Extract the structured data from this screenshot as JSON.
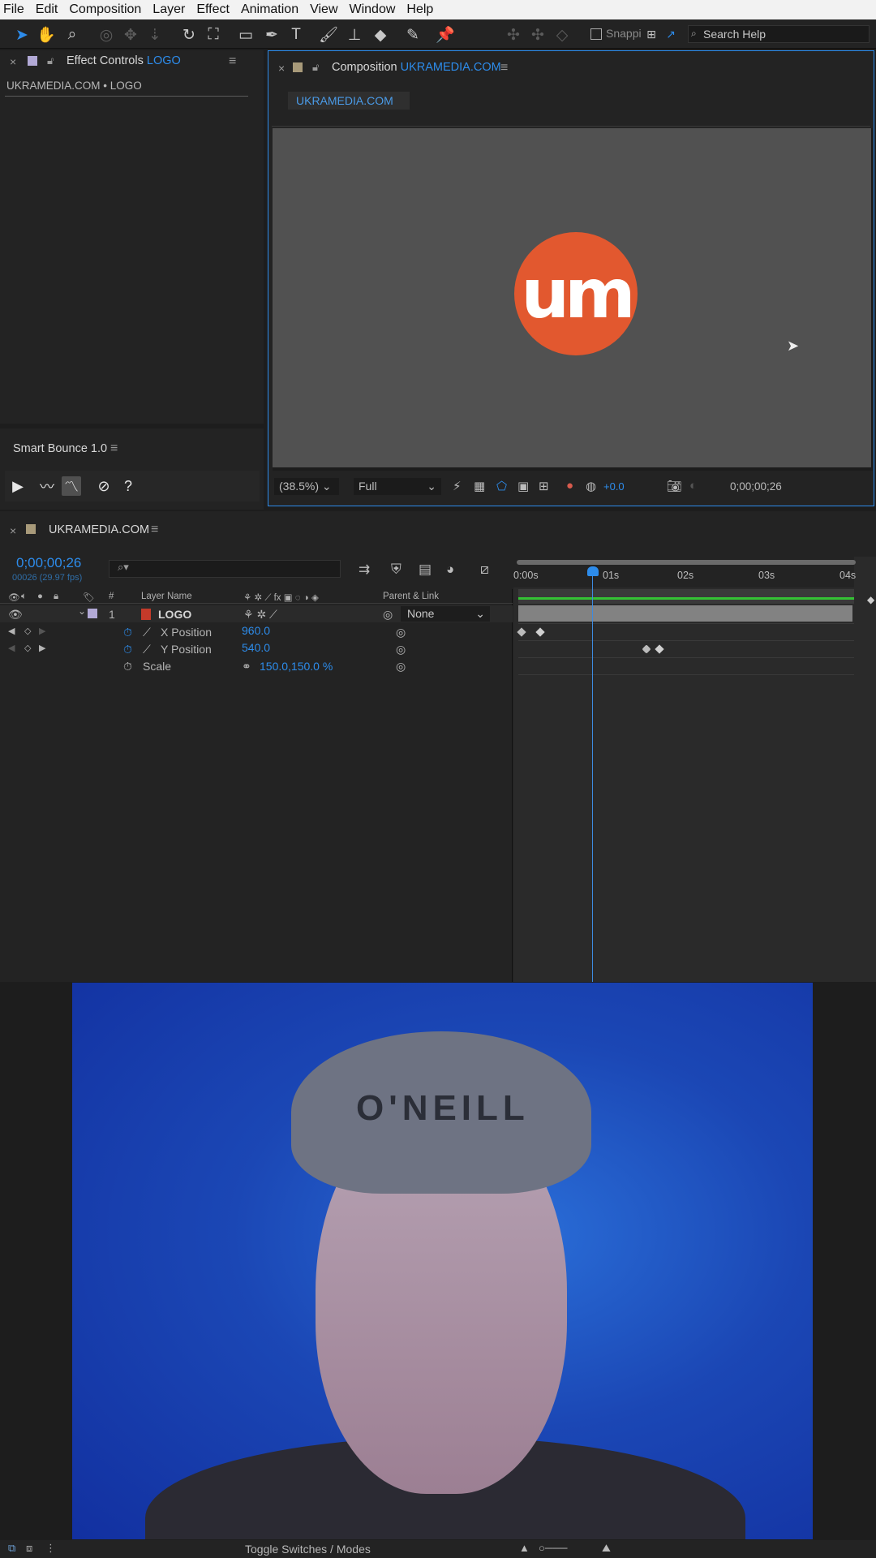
{
  "menu": [
    "File",
    "Edit",
    "Composition",
    "Layer",
    "Effect",
    "Animation",
    "View",
    "Window",
    "Help"
  ],
  "toolbar": {
    "snapping_label": "Snappi",
    "search_placeholder": "Search Help"
  },
  "effect_controls": {
    "title_prefix": "Effect Controls",
    "title_layer": "LOGO",
    "subtitle": "UKRAMEDIA.COM • LOGO"
  },
  "smart_bounce": {
    "title": "Smart Bounce 1.0",
    "help_label": "?"
  },
  "composition": {
    "title_prefix": "Composition",
    "title_name": "UKRAMEDIA.COM",
    "tab_label": "UKRAMEDIA.COM",
    "logo_text": "um",
    "zoom": "(38.5%)",
    "resolution": "Full",
    "exposure": "+0.0",
    "timecode": "0;00;00;26",
    "accent_color": "#2d8ceb",
    "logo_color": "#e2582f"
  },
  "timeline": {
    "comp_name": "UKRAMEDIA.COM",
    "timecode": "0;00;00;26",
    "frames_fps": "00026 (29.97 fps)",
    "search_placeholder": "⌕▾",
    "headers": {
      "number": "#",
      "layer_name": "Layer Name",
      "parent_link": "Parent & Link"
    },
    "layer": {
      "index": "1",
      "name": "LOGO",
      "parent": "None"
    },
    "properties": [
      {
        "name": "X Position",
        "value": "960.0"
      },
      {
        "name": "Y Position",
        "value": "540.0"
      },
      {
        "name": "Scale",
        "value": "150.0,150.0 %"
      }
    ],
    "ruler": [
      "0:00s",
      "01s",
      "02s",
      "03s",
      "04s"
    ]
  },
  "webcam": {
    "cap_text": "O'NEILL"
  },
  "bottom": {
    "toggle_label": "Toggle Switches / Modes"
  }
}
